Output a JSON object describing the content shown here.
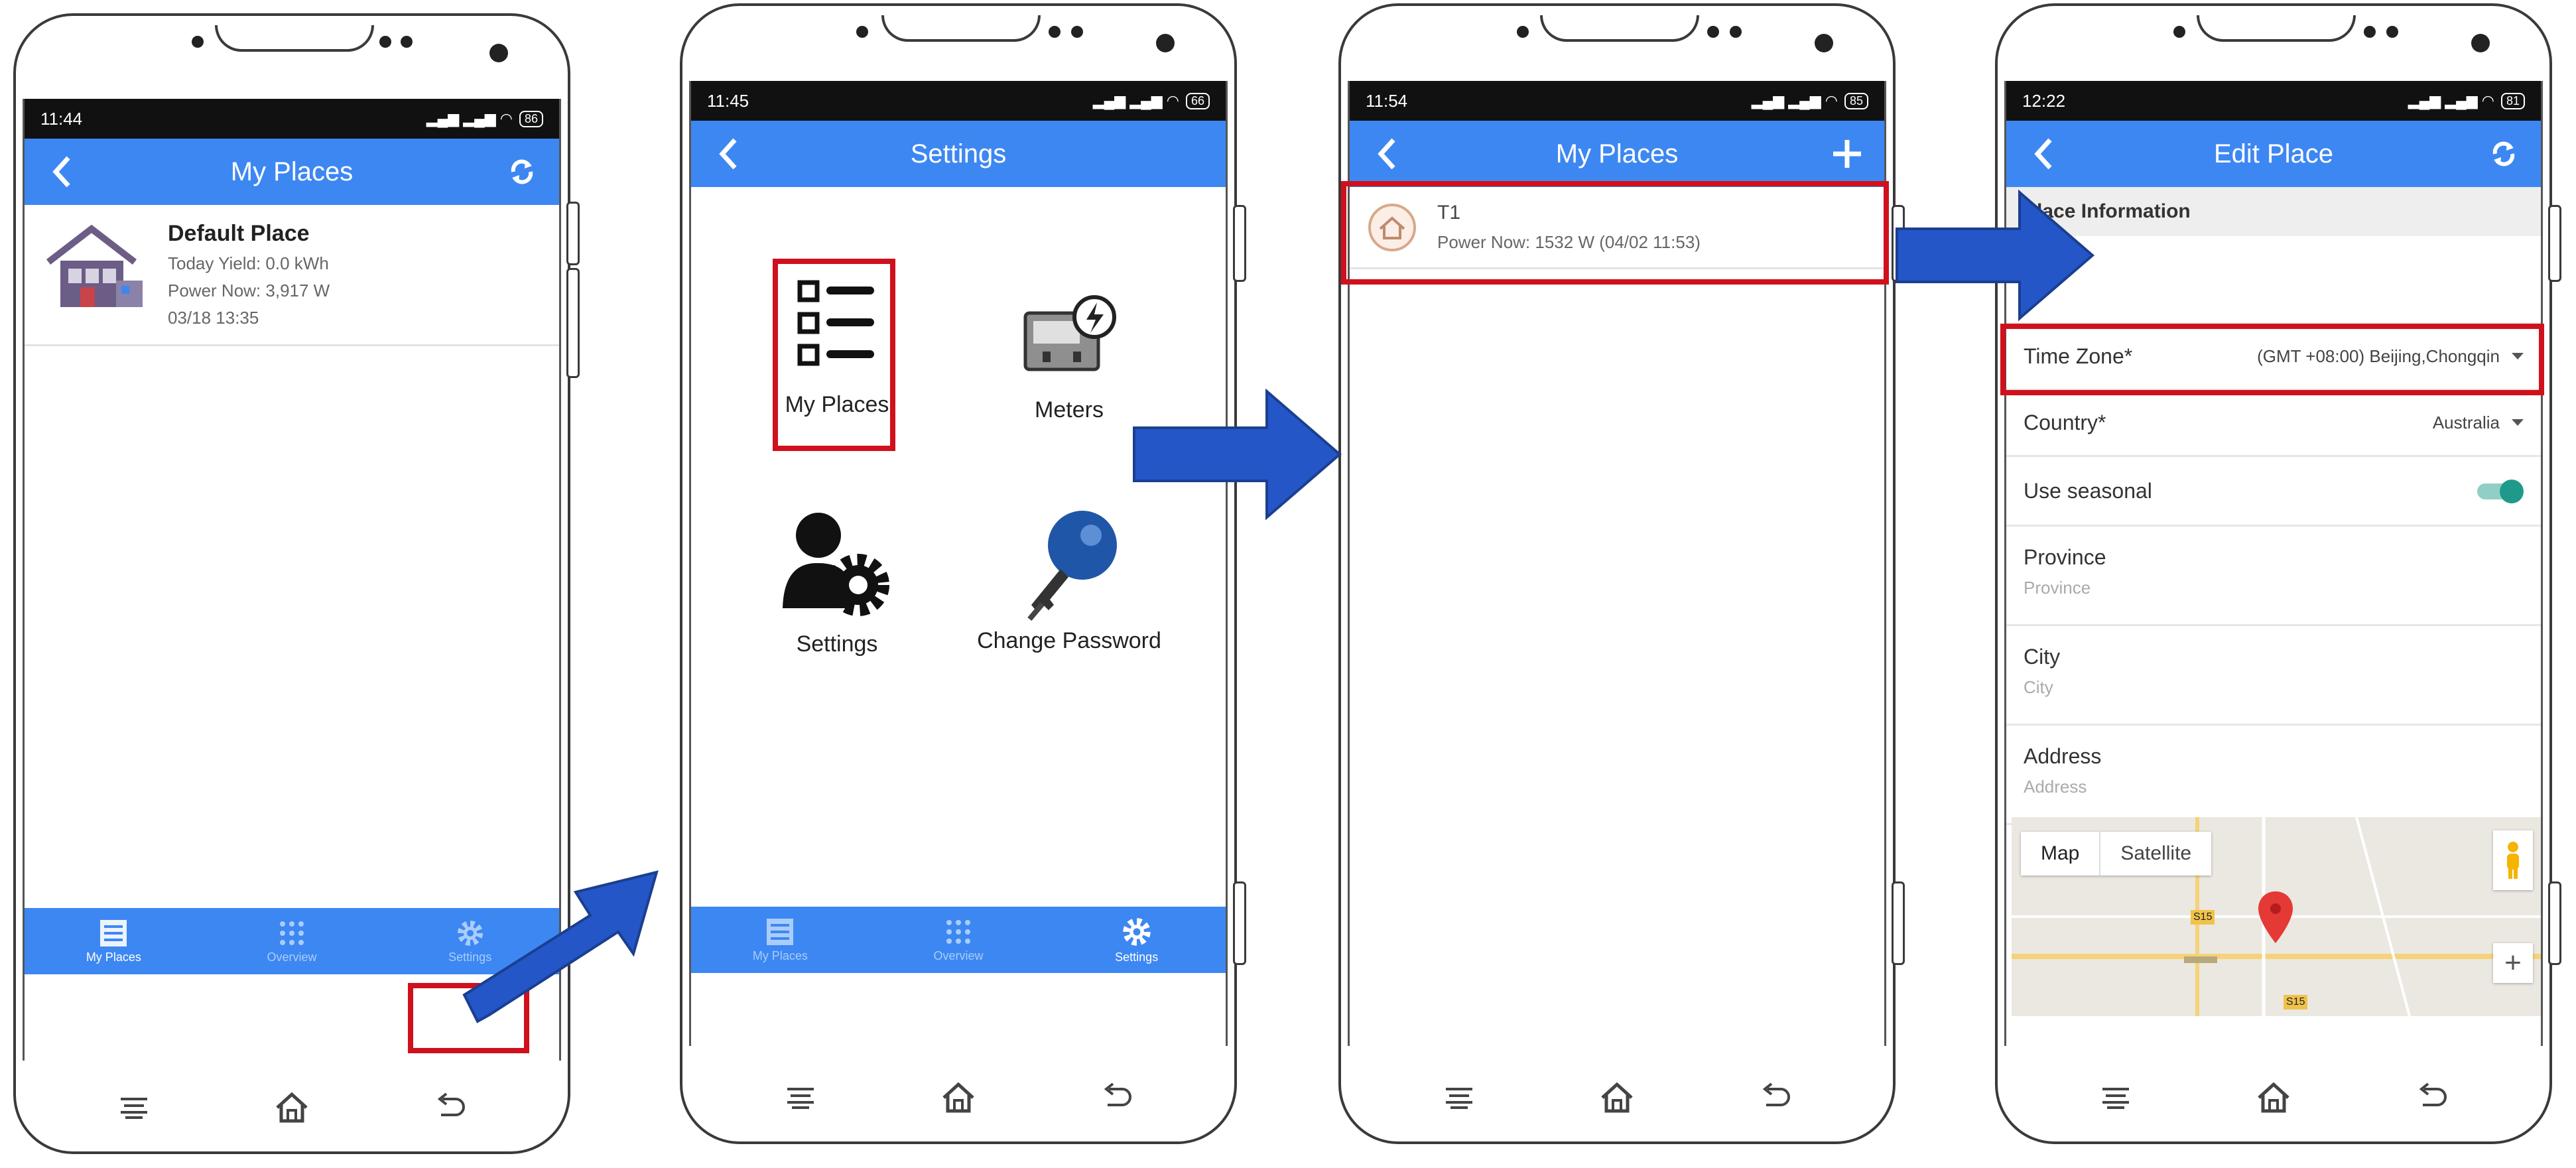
{
  "phone1": {
    "time": "11:44",
    "battery": "86",
    "title": "My Places",
    "place": {
      "name": "Default Place",
      "yield": "Today Yield: 0.0 kWh",
      "power": "Power Now: 3,917 W",
      "date": "03/18 13:35"
    },
    "nav": [
      "My Places",
      "Overview",
      "Settings"
    ]
  },
  "phone2": {
    "time": "11:45",
    "battery": "66",
    "title": "Settings",
    "tiles": [
      "My Places",
      "Meters",
      "Settings",
      "Change Password"
    ],
    "nav": [
      "My Places",
      "Overview",
      "Settings"
    ]
  },
  "phone3": {
    "time": "11:54",
    "battery": "85",
    "title": "My Places",
    "place": {
      "name": "T1",
      "power": "Power Now: 1532 W (04/02 11:53)"
    }
  },
  "phone4": {
    "time": "12:22",
    "battery": "81",
    "title": "Edit Place",
    "section": "Place Information",
    "timezone_label": "Time Zone*",
    "timezone_value": "(GMT +08:00) Beijing,Chongqin",
    "country_label": "Country*",
    "country_value": "Australia",
    "seasonal_label": "Use seasonal",
    "province_label": "Province",
    "province_ph": "Province",
    "city_label": "City",
    "city_ph": "City",
    "address_label": "Address",
    "address_ph": "Address",
    "map_btn": "Map",
    "satellite_btn": "Satellite",
    "map_labels": [
      "S15",
      "S15"
    ],
    "zoom_in": "+"
  },
  "colors": {
    "accent": "#3d87f2",
    "highlight": "#d0101c",
    "arrow": "#2456c8",
    "toggle": "#1f9a8a"
  },
  "icons": [
    "back-icon",
    "refresh-icon",
    "add-icon",
    "list-icon",
    "grid-icon",
    "gear-icon",
    "meter-icon",
    "user-gear-icon",
    "key-icon",
    "house-icon",
    "menu-icon",
    "home-icon",
    "return-icon",
    "dropdown-icon",
    "pegman-icon",
    "map-pin-icon"
  ]
}
